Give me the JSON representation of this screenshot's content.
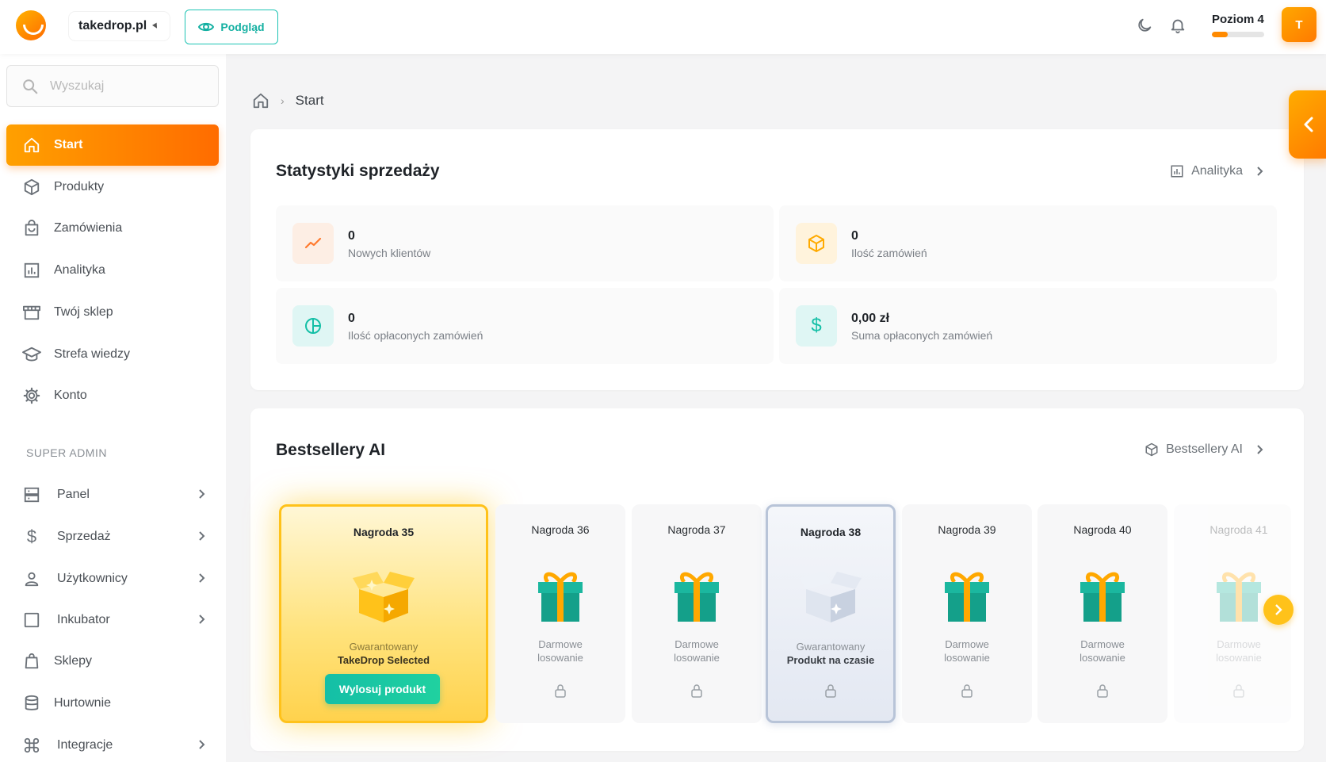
{
  "header": {
    "shop_name": "takedrop.pl",
    "preview_label": "Podgląd",
    "level_label": "Poziom 4",
    "level_progress": 0.3,
    "avatar_initial": "T"
  },
  "colors": {
    "accent": "#ff8a00",
    "teal": "#14bfa6",
    "gold": "#ffc21a"
  },
  "sidebar": {
    "search_placeholder": "Wyszukaj",
    "items": [
      {
        "label": "Start",
        "icon": "home-icon",
        "active": true
      },
      {
        "label": "Produkty",
        "icon": "box-icon"
      },
      {
        "label": "Zamówienia",
        "icon": "bag-icon"
      },
      {
        "label": "Analityka",
        "icon": "chart-icon"
      },
      {
        "label": "Twój sklep",
        "icon": "store-icon"
      },
      {
        "label": "Strefa wiedzy",
        "icon": "graduation-cap-icon"
      },
      {
        "label": "Konto",
        "icon": "gear-icon"
      }
    ],
    "section_label": "SUPER ADMIN",
    "admin_items": [
      {
        "label": "Panel",
        "icon": "server-icon",
        "has_submenu": true
      },
      {
        "label": "Sprzedaż",
        "icon": "dollar-icon",
        "has_submenu": true
      },
      {
        "label": "Użytkownicy",
        "icon": "user-icon",
        "has_submenu": true
      },
      {
        "label": "Inkubator",
        "icon": "square-icon",
        "has_submenu": true
      },
      {
        "label": "Sklepy",
        "icon": "shopping-bag-icon",
        "has_submenu": false
      },
      {
        "label": "Hurtownie",
        "icon": "database-icon",
        "has_submenu": false
      },
      {
        "label": "Integracje",
        "icon": "command-icon",
        "has_submenu": true
      }
    ]
  },
  "breadcrumb": {
    "current": "Start"
  },
  "stats": {
    "title": "Statystyki sprzedaży",
    "link_label": "Analityka",
    "items": [
      {
        "value": "0",
        "label": "Nowych klientów",
        "icon": "trend-up-icon"
      },
      {
        "value": "0",
        "label": "Ilość zamówień",
        "icon": "package-icon"
      },
      {
        "value": "0",
        "label": "Ilość opłaconych zamówień",
        "icon": "pie-chart-icon"
      },
      {
        "value": "0,00 zł",
        "label": "Suma opłaconych zamówień",
        "icon": "dollar-icon"
      }
    ]
  },
  "bestsellers": {
    "title": "Bestsellery AI",
    "link_label": "Bestsellery AI",
    "prizes": [
      {
        "title": "Nagroda 35",
        "desc_line1": "Gwarantowany",
        "desc_line2": "TakeDrop Selected",
        "button": "Wylosuj produkt"
      },
      {
        "title": "Nagroda 36",
        "desc_line1": "Darmowe",
        "desc_line2": "losowanie"
      },
      {
        "title": "Nagroda 37",
        "desc_line1": "Darmowe",
        "desc_line2": "losowanie"
      },
      {
        "title": "Nagroda 38",
        "desc_line1": "Gwarantowany",
        "desc_line2": "Produkt na czasie"
      },
      {
        "title": "Nagroda 39",
        "desc_line1": "Darmowe",
        "desc_line2": "losowanie"
      },
      {
        "title": "Nagroda 40",
        "desc_line1": "Darmowe",
        "desc_line2": "losowanie"
      },
      {
        "title": "Nagroda 41",
        "desc_line1": "Darmowe",
        "desc_line2": "losowanie"
      }
    ]
  }
}
